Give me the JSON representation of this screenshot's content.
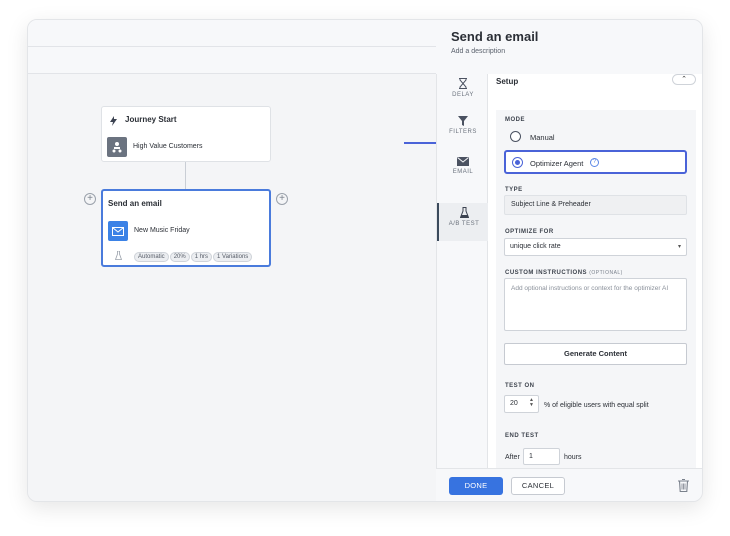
{
  "panel": {
    "title": "Send an email",
    "description_placeholder": "Add a description"
  },
  "sidebar": {
    "items": [
      {
        "label": "DELAY",
        "icon": "hourglass-icon"
      },
      {
        "label": "FILTERS",
        "icon": "funnel-icon"
      },
      {
        "label": "EMAIL",
        "icon": "envelope-icon"
      },
      {
        "label": "A/B TEST",
        "icon": "flask-icon",
        "active": true
      }
    ]
  },
  "canvas": {
    "start_node": {
      "title": "Journey Start",
      "segment": "High Value Customers"
    },
    "email_node": {
      "title": "Send an email",
      "campaign": "New Music Friday",
      "tags": [
        "Automatic",
        "20%",
        "1 hrs",
        "1 Variations"
      ]
    }
  },
  "form": {
    "section_title": "Setup",
    "mode_label": "MODE",
    "mode_options": [
      "Manual",
      "Optimizer Agent"
    ],
    "mode_selected": "Optimizer Agent",
    "type_label": "TYPE",
    "type_value": "Subject Line & Preheader",
    "optimize_label": "OPTIMIZE FOR",
    "optimize_value": "unique click rate",
    "custom_label": "CUSTOM INSTRUCTIONS",
    "custom_optional": "(OPTIONAL)",
    "custom_placeholder": "Add optional instructions or context for the optimizer AI",
    "generate_button": "Generate Content",
    "test_on_label": "TEST ON",
    "test_on_value": "20",
    "test_on_suffix": "% of eligible users with equal split",
    "end_test_label": "END TEST",
    "end_after_prefix": "After",
    "end_after_value": "1",
    "end_after_suffix": "hours"
  },
  "footer": {
    "done": "DONE",
    "cancel": "CANCEL"
  },
  "colors": {
    "accent": "#3773e0",
    "highlight": "#4a63d8",
    "email_icon_bg": "#3b82e6",
    "start_icon_bg": "#6b7380"
  }
}
